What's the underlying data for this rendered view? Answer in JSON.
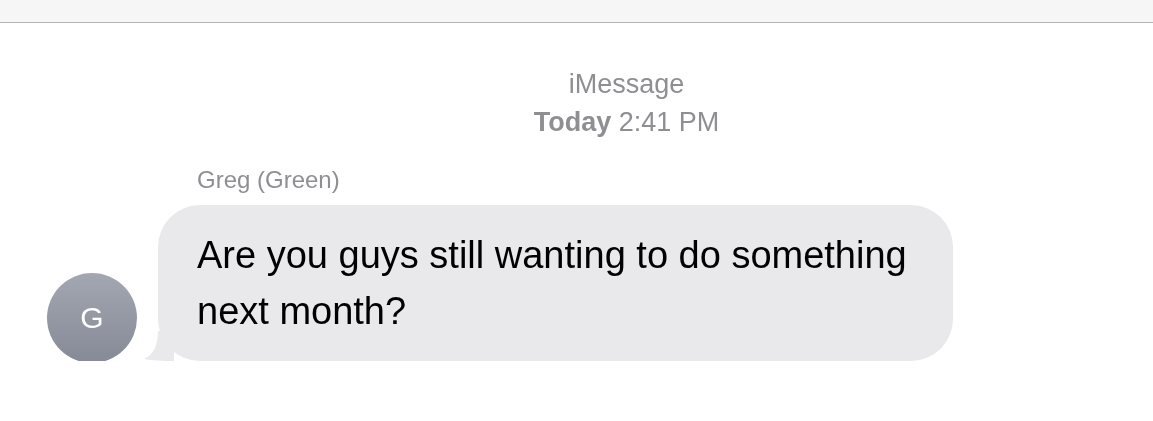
{
  "service": "iMessage",
  "timestamp": "**Today** 2:41 PM",
  "messages": [
    {
      "sender": "Greg (Green)",
      "avatar": "G",
      "text": "Are you guys still wanting to do something next month?"
    }
  ]
}
